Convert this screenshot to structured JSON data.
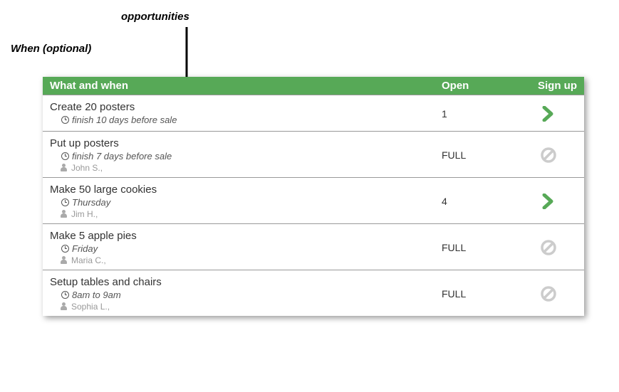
{
  "annotations": {
    "topLine2": "opportunities",
    "left": "When (optional)"
  },
  "header": {
    "whatWhen": "What and when",
    "open": "Open",
    "signup": "Sign up"
  },
  "rows": [
    {
      "title": "Create 20 posters",
      "when": "finish 10 days before sale",
      "who": "",
      "open": "1",
      "status": "open"
    },
    {
      "title": "Put up posters",
      "when": "finish 7 days before sale",
      "who": "John S.,",
      "open": "FULL",
      "status": "full"
    },
    {
      "title": "Make 50 large cookies",
      "when": "Thursday",
      "who": "Jim H.,",
      "open": "4",
      "status": "open"
    },
    {
      "title": "Make 5 apple pies",
      "when": "Friday",
      "who": "Maria C.,",
      "open": "FULL",
      "status": "full"
    },
    {
      "title": "Setup tables and chairs",
      "when": "8am to 9am",
      "who": "Sophia L.,",
      "open": "FULL",
      "status": "full"
    }
  ]
}
